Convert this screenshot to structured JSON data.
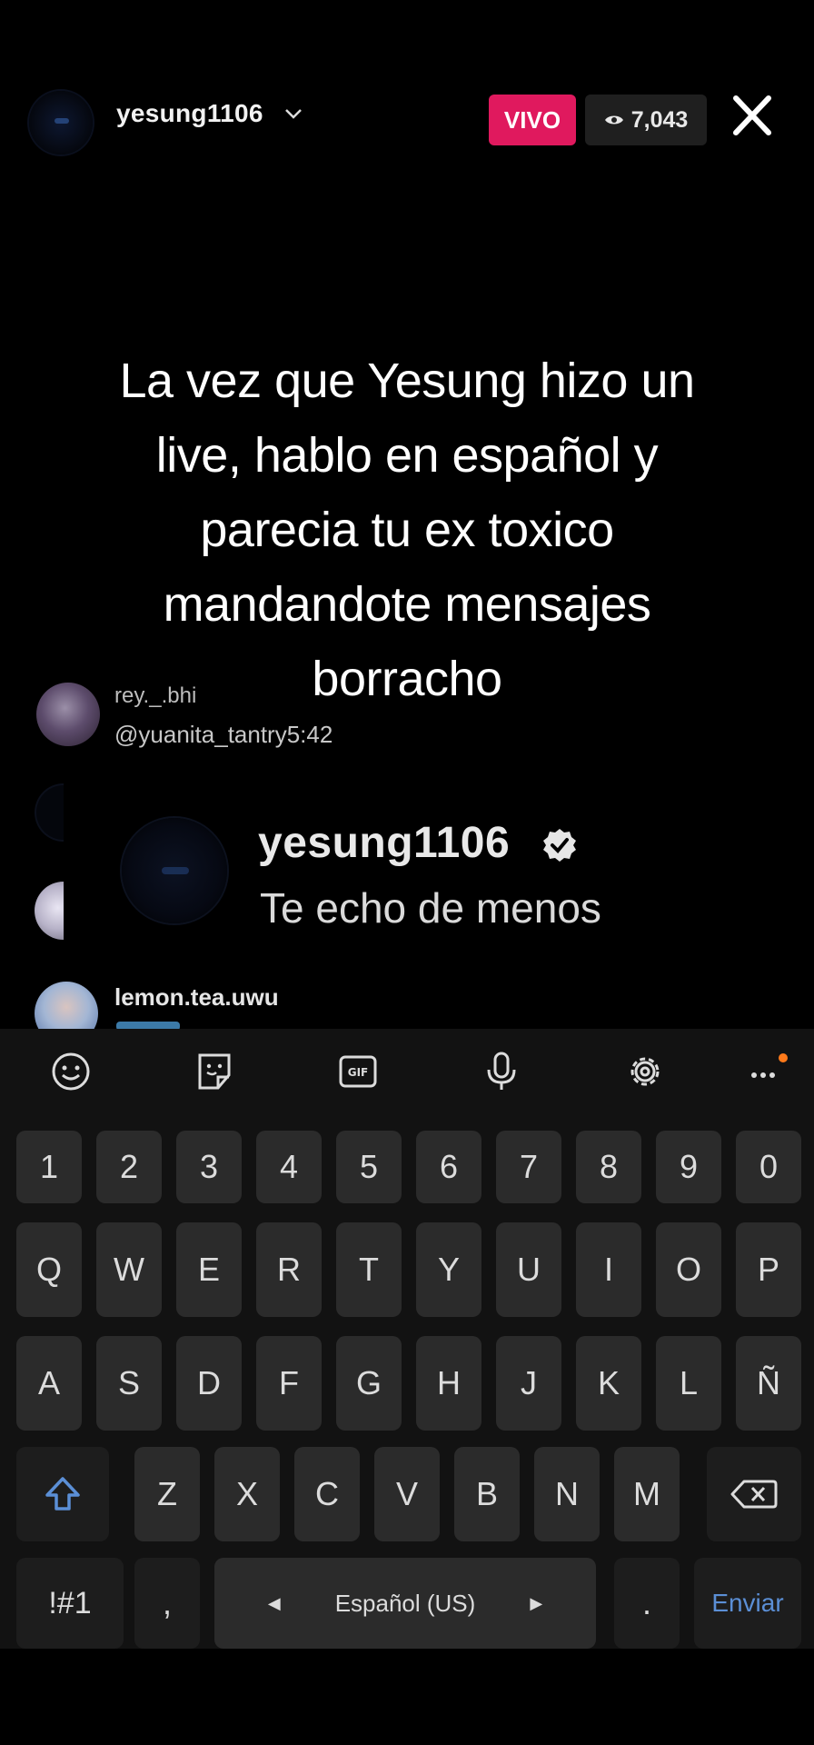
{
  "header": {
    "username": "yesung1106",
    "live_label": "VIVO",
    "viewer_count": "7,043"
  },
  "caption": {
    "lines": [
      "La vez que Yesung hizo un",
      "live, hablo en español y",
      "parecia tu ex toxico",
      "mandandote mensajes",
      "borracho"
    ]
  },
  "comments": [
    {
      "user": "rey._.bhi",
      "text": "@yuanita_tantry5:42"
    },
    {
      "user": "lemon.tea.uwu",
      "text": ""
    }
  ],
  "popup": {
    "user": "yesung1106",
    "message": "Te echo de menos"
  },
  "keyboard": {
    "toolbar": [
      "emoji-icon",
      "sticker-icon",
      "gif-icon",
      "microphone-icon",
      "settings-icon",
      "more-icon"
    ],
    "row_numbers": [
      "1",
      "2",
      "3",
      "4",
      "5",
      "6",
      "7",
      "8",
      "9",
      "0"
    ],
    "row_1": [
      "Q",
      "W",
      "E",
      "R",
      "T",
      "Y",
      "U",
      "I",
      "O",
      "P"
    ],
    "row_2": [
      "A",
      "S",
      "D",
      "F",
      "G",
      "H",
      "J",
      "K",
      "L",
      "Ñ"
    ],
    "row_3": [
      "Z",
      "X",
      "C",
      "V",
      "B",
      "N",
      "M"
    ],
    "symbols_key": "!#1",
    "comma_key": ",",
    "space_label": "Español (US)",
    "period_key": ".",
    "send_label": "Enviar",
    "send_color": "#5b8fd6"
  },
  "colors": {
    "live_badge": "#e0195e",
    "shift_icon": "#5b8fd6",
    "notification_dot": "#ff7a1a"
  }
}
